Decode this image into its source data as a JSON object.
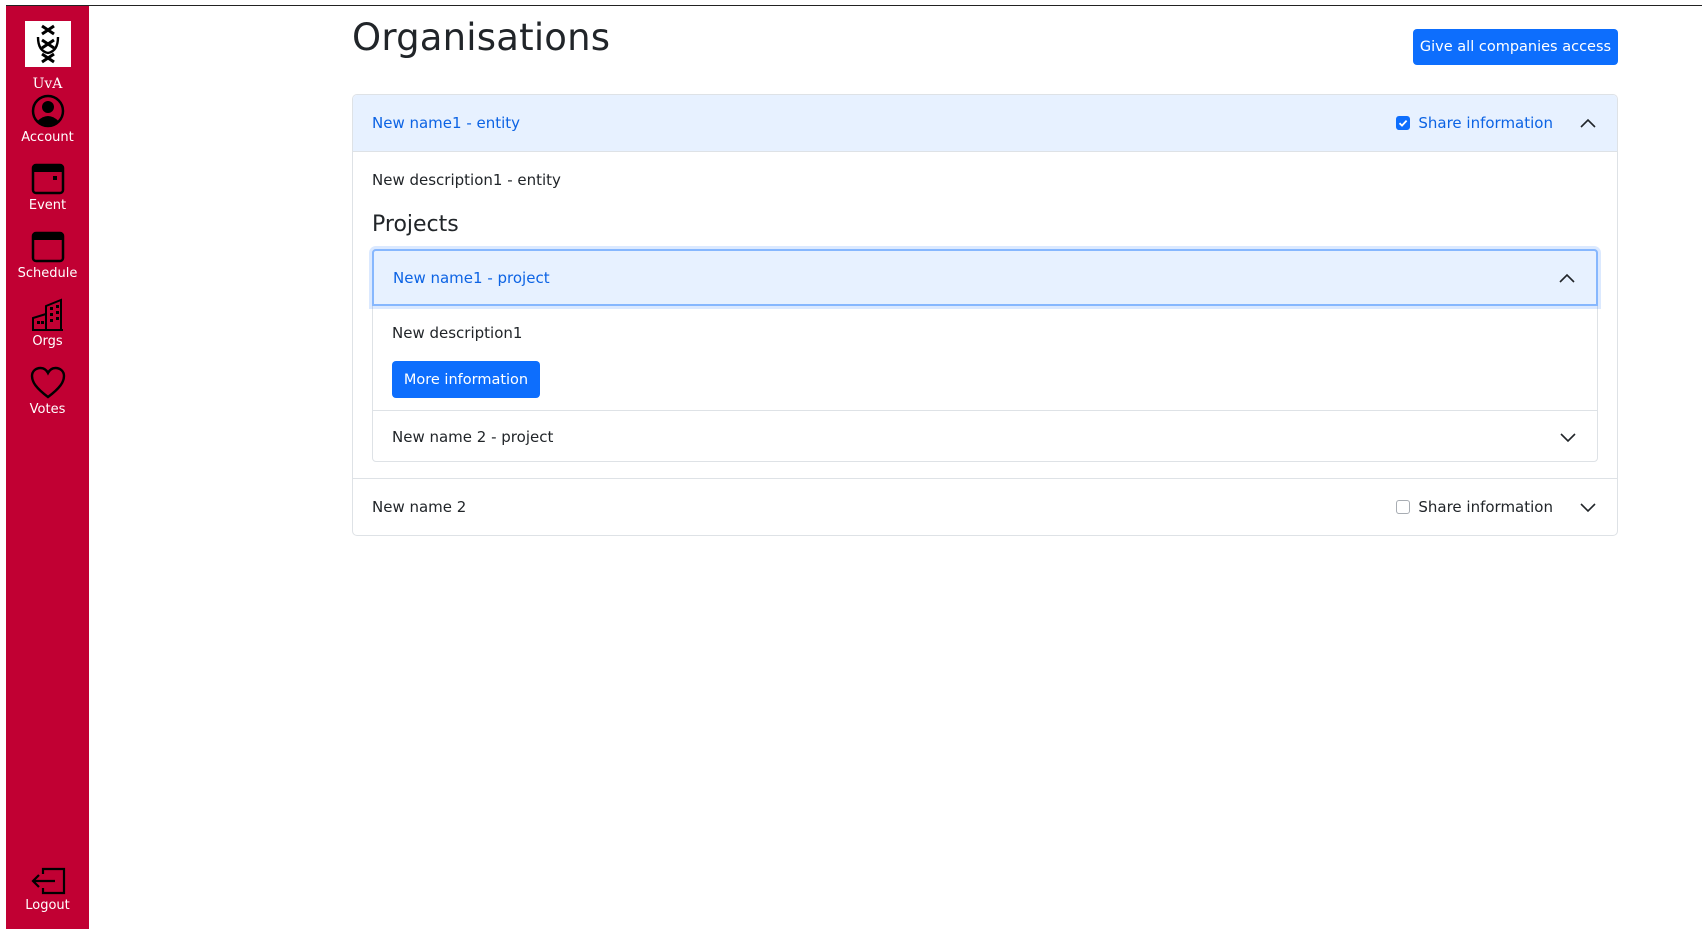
{
  "sidebar": {
    "logo_text": "UvA",
    "items": [
      {
        "label": "Account",
        "icon": "account-icon"
      },
      {
        "label": "Event",
        "icon": "event-icon"
      },
      {
        "label": "Schedule",
        "icon": "schedule-icon"
      },
      {
        "label": "Orgs",
        "icon": "orgs-icon"
      },
      {
        "label": "Votes",
        "icon": "votes-icon"
      }
    ],
    "logout_label": "Logout",
    "color": "#c10033"
  },
  "header": {
    "title": "Organisations",
    "give_access_label": "Give all companies access"
  },
  "organisations": [
    {
      "name": "New name1 - entity",
      "expanded": true,
      "share_label": "Share information",
      "share_checked": true,
      "description": "New description1 - entity",
      "projects_heading": "Projects",
      "projects": [
        {
          "name": "New name1 - project",
          "expanded": true,
          "description": "New description1",
          "more_label": "More information"
        },
        {
          "name": "New name 2 - project",
          "expanded": false
        }
      ]
    },
    {
      "name": "New name 2",
      "expanded": false,
      "share_label": "Share information",
      "share_checked": false
    }
  ],
  "colors": {
    "primary": "#0d6efd",
    "active_header_bg": "#e7f1ff",
    "active_header_text": "#0c63e4"
  }
}
